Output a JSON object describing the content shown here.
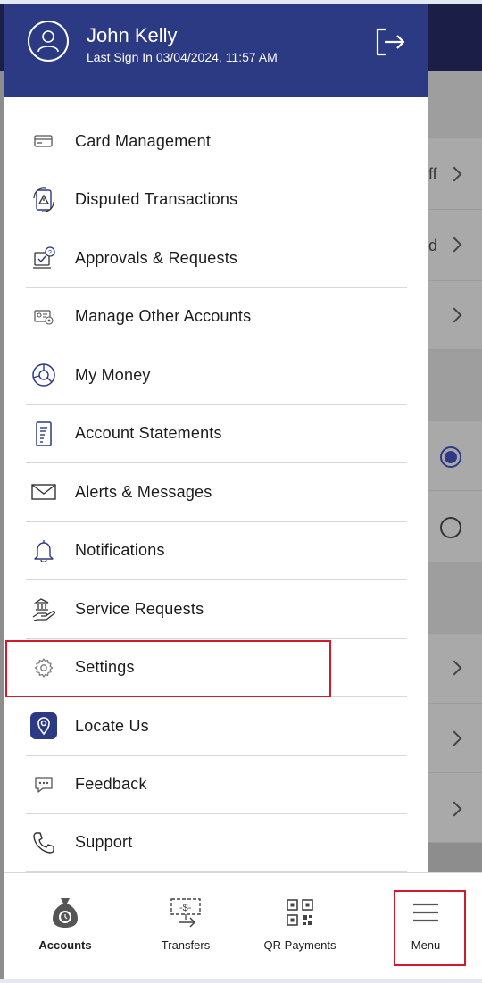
{
  "user": {
    "name": "John Kelly",
    "last_sign_in": "Last Sign In 03/04/2024, 11:57 AM"
  },
  "background": {
    "row_texts": [
      "ff",
      "d"
    ]
  },
  "menu": {
    "items": [
      {
        "label": "Card Management",
        "icon": "card-icon"
      },
      {
        "label": "Disputed Transactions",
        "icon": "dispute-icon"
      },
      {
        "label": "Approvals & Requests",
        "icon": "approval-icon"
      },
      {
        "label": "Manage Other Accounts",
        "icon": "manage-accounts-icon"
      },
      {
        "label": "My Money",
        "icon": "pie-chart-icon"
      },
      {
        "label": "Account Statements",
        "icon": "statement-icon"
      },
      {
        "label": "Alerts & Messages",
        "icon": "envelope-icon"
      },
      {
        "label": "Notifications",
        "icon": "bell-icon"
      },
      {
        "label": "Service Requests",
        "icon": "service-hand-icon"
      },
      {
        "label": "Settings",
        "icon": "gear-icon"
      },
      {
        "label": "Locate Us",
        "icon": "location-pin-icon"
      },
      {
        "label": "Feedback",
        "icon": "chat-bubble-icon"
      },
      {
        "label": "Support",
        "icon": "phone-icon"
      }
    ]
  },
  "bottom_nav": {
    "items": [
      {
        "label": "Accounts",
        "icon": "money-bag-icon",
        "active": true
      },
      {
        "label": "Transfers",
        "icon": "transfer-icon",
        "active": false
      },
      {
        "label": "QR Payments",
        "icon": "qr-code-icon",
        "active": false
      },
      {
        "label": "Menu",
        "icon": "hamburger-icon",
        "active": false
      }
    ]
  },
  "colors": {
    "header": "#2c3a84",
    "highlight": "#d11a2a",
    "overlay": "#8d8d8d"
  }
}
